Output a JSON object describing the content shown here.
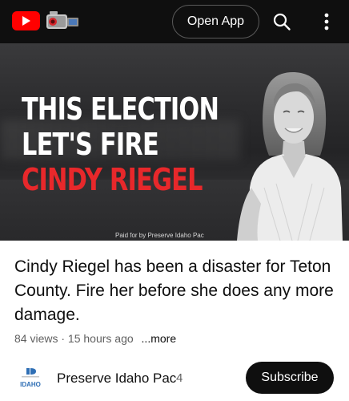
{
  "topbar": {
    "open_app_label": "Open App",
    "icons": [
      "youtube-logo",
      "camcorder-icon",
      "search-icon",
      "more-vert-icon"
    ]
  },
  "video": {
    "thumbnail": {
      "headline_line1": "THIS ELECTION",
      "headline_line2": "LET'S FIRE",
      "headline_line3": "CINDY RIEGEL",
      "paid_for": "Paid for by Preserve Idaho Pac"
    },
    "title": "Cindy Riegel has been a disaster for Teton County. Fire her before she does any more damage.",
    "views": "84 views",
    "separator": "·",
    "age": "15 hours ago",
    "more_label": "...more"
  },
  "channel": {
    "name": "Preserve Idaho Pac",
    "subscriber_count": "4",
    "logo_text": "IDAHO",
    "subscribe_label": "Subscribe"
  },
  "colors": {
    "topbar_bg": "#0f0f0f",
    "brand_red": "#ff0000",
    "headline_red": "#e8282b",
    "subscribe_bg": "#0f0f0f"
  }
}
